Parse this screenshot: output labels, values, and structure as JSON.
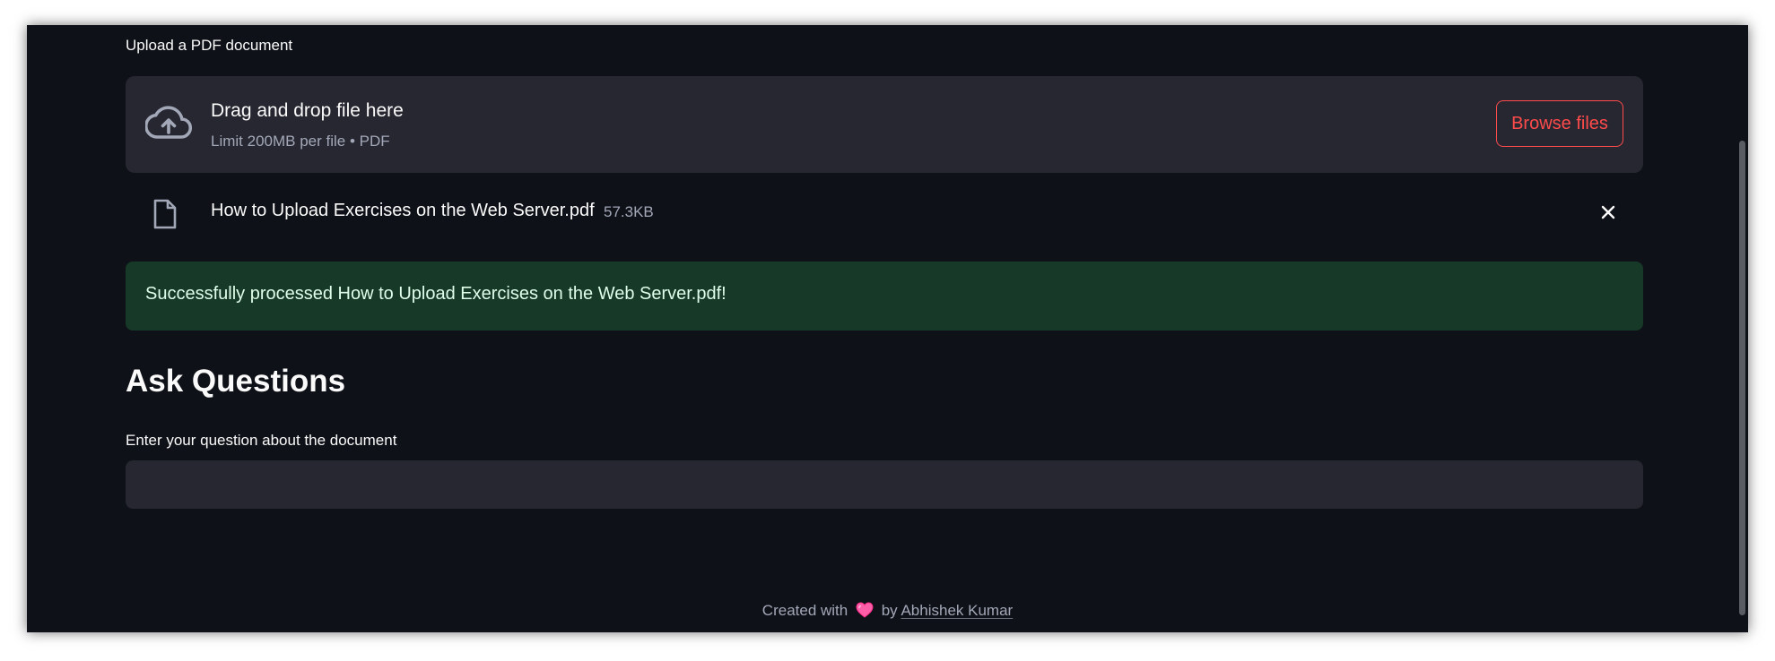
{
  "uploader": {
    "label": "Upload a PDF document",
    "dropzone_title": "Drag and drop file here",
    "dropzone_subtitle": "Limit 200MB per file • PDF",
    "browse_label": "Browse files",
    "icon": "cloud-upload-icon"
  },
  "uploaded_file": {
    "name": "How to Upload Exercises on the Web Server.pdf",
    "size": "57.3KB",
    "icon": "file-icon",
    "remove_icon": "close-icon"
  },
  "alert": {
    "message": "Successfully processed How to Upload Exercises on the Web Server.pdf!",
    "color": "#173928"
  },
  "questions": {
    "heading": "Ask Questions",
    "input_label": "Enter your question about the document",
    "input_value": "",
    "input_placeholder": ""
  },
  "footer": {
    "prefix": "Created with",
    "heart_icon": "heart-icon",
    "by": "by",
    "author": "Abhishek Kumar"
  },
  "colors": {
    "background": "#0e1117",
    "surface": "#262730",
    "accent": "#ff4b4b",
    "success_bg": "#173928",
    "text": "#fafafa",
    "muted": "#a3a8b8"
  }
}
